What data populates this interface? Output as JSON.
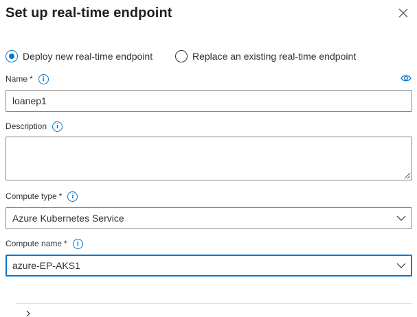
{
  "panel": {
    "title": "Set up real-time endpoint",
    "close_icon": "close-icon"
  },
  "deploy_mode": {
    "options": [
      {
        "label": "Deploy new real-time endpoint",
        "selected": true
      },
      {
        "label": "Replace an existing real-time endpoint",
        "selected": false
      }
    ]
  },
  "name_field": {
    "label": "Name",
    "required_mark": "*",
    "info_icon": "info-icon",
    "visibility_icon": "eye-icon",
    "value": "loanep1"
  },
  "description_field": {
    "label": "Description",
    "info_icon": "info-icon",
    "value": ""
  },
  "compute_type_field": {
    "label": "Compute type",
    "required_mark": "*",
    "info_icon": "info-icon",
    "selected": "Azure Kubernetes Service"
  },
  "compute_name_field": {
    "label": "Compute name",
    "required_mark": "*",
    "info_icon": "info-icon",
    "selected": "azure-EP-AKS1"
  },
  "colors": {
    "accent": "#0078d4",
    "border": "#8a8886",
    "text": "#323130"
  }
}
